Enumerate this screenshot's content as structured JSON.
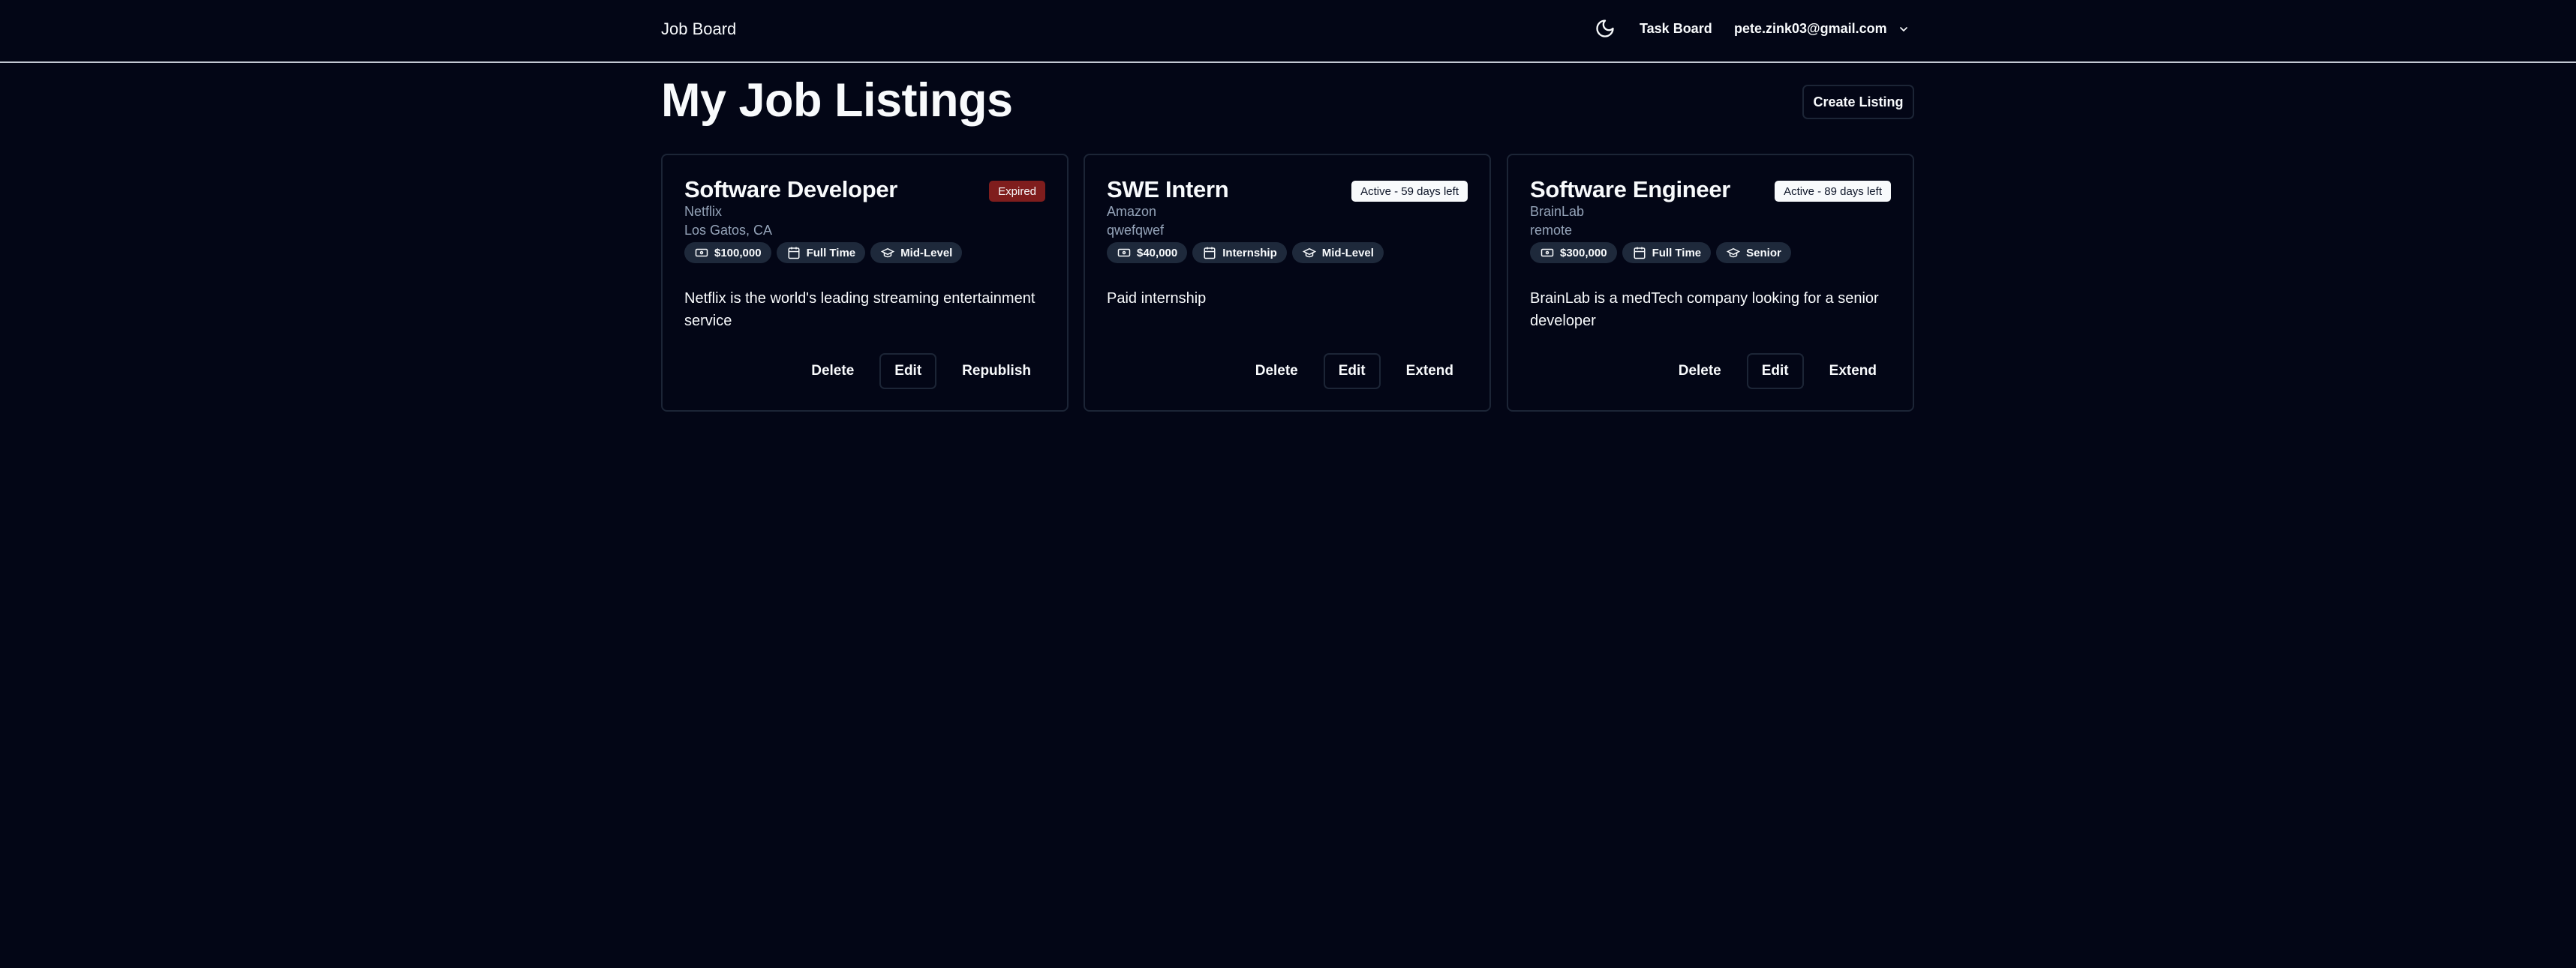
{
  "header": {
    "brand": "Job Board",
    "theme_icon": "moon-icon",
    "nav_link": "Task Board",
    "user_email": "pete.zink03@gmail.com",
    "user_menu_icon": "chevron-down-icon"
  },
  "page": {
    "title": "My Job Listings",
    "create_label": "Create Listing"
  },
  "listings": [
    {
      "title": "Software Developer",
      "status": "Expired",
      "company": "Netflix",
      "location": "Los Gatos, CA",
      "salary": "$100,000",
      "type": "Full Time",
      "level": "Mid-Level",
      "description": "Netflix is the world's leading streaming entertainment service",
      "actions": {
        "delete": "Delete",
        "edit": "Edit",
        "secondary": "Republish"
      }
    },
    {
      "title": "SWE Intern",
      "status": "Active - 59 days left",
      "company": "Amazon",
      "location": "qwefqwef",
      "salary": "$40,000",
      "type": "Internship",
      "level": "Mid-Level",
      "description": "Paid internship",
      "actions": {
        "delete": "Delete",
        "edit": "Edit",
        "secondary": "Extend"
      }
    },
    {
      "title": "Software Engineer",
      "status": "Active - 89 days left",
      "company": "BrainLab",
      "location": "remote",
      "salary": "$300,000",
      "type": "Full Time",
      "level": "Senior",
      "description": "BrainLab is a medTech company looking for a senior developer",
      "actions": {
        "delete": "Delete",
        "edit": "Edit",
        "secondary": "Extend"
      }
    }
  ],
  "colors": {
    "background": "#030616",
    "border": "#1c2536",
    "expired_badge": "#7f1d1d",
    "active_badge": "#f8fafc",
    "chip": "#1e293b",
    "muted_text": "#94a3b8"
  }
}
